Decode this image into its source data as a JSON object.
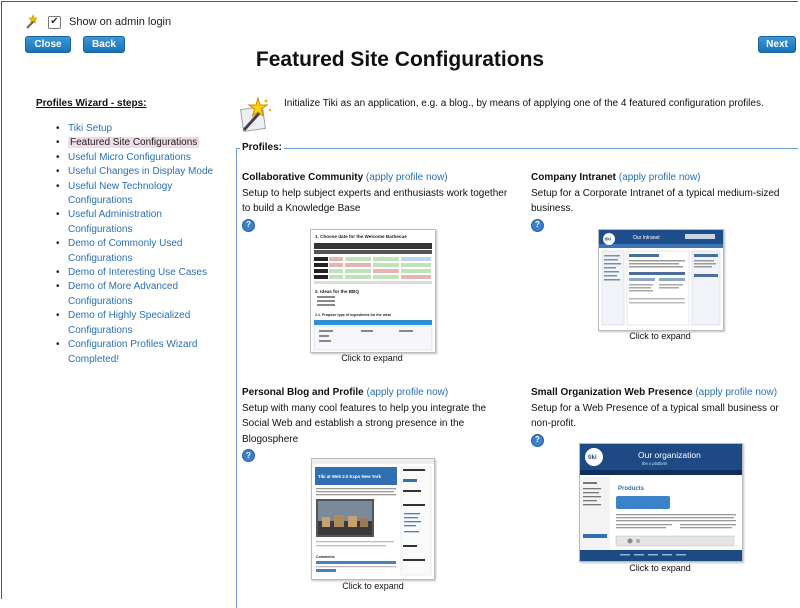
{
  "admin": {
    "show_label": "Show on admin login",
    "checked": true
  },
  "buttons": {
    "close": "Close",
    "back": "Back",
    "next": "Next"
  },
  "page_title": "Featured Site Configurations",
  "wizard": {
    "title": "Profiles Wizard - steps:",
    "steps": [
      "Tiki Setup",
      "Featured Site Configurations",
      "Useful Micro Configurations",
      "Useful Changes in Display Mode",
      "Useful New Technology Configurations",
      "Useful Administration Configurations",
      "Demo of Commonly Used Configurations",
      "Demo of Interesting Use Cases",
      "Demo of More Advanced Configurations",
      "Demo of Highly Specialized Configurations",
      "Configuration Profiles Wizard Completed!"
    ],
    "current_index": 1
  },
  "intro": "Initialize Tiki as an application, e.g. a blog., by means of applying one of the 4 featured configuration profiles.",
  "profiles_legend": "Profiles:",
  "profiles": [
    {
      "name": "Collaborative Community",
      "apply": "(apply profile now)",
      "desc": "Setup to help subject experts and enthusiasts work together to build a Knowledge Base",
      "caption": "Click to expand"
    },
    {
      "name": "Company Intranet",
      "apply": "(apply profile now)",
      "desc": "Setup for a Corporate Intranet of a typical medium-sized business.",
      "caption": "Click to expand"
    },
    {
      "name": "Personal Blog and Profile",
      "apply": "(apply profile now)",
      "desc": "Setup with many cool features to help you integrate the Social Web and establish a strong presence in the Blogosphere",
      "caption": "Click to expand"
    },
    {
      "name": "Small Organization Web Presence",
      "apply": "(apply profile now)",
      "desc": "Setup for a Web Presence of a typical small business or non-profit.",
      "caption": "Click to expand"
    }
  ],
  "thumbnails": {
    "collab_heading": "1. Choose date for the Welcome Barbecue",
    "collab_section": "2. Ideas for the BBQ",
    "collab_sub": "2.1. Propose type of ingredients for the meal",
    "intranet_logo": "tiki",
    "intranet_title": "Our Intranet",
    "blog_title": "Tiki at Web 2.0 Expo New York",
    "blog_comments": "Comments",
    "org_logo": "tiki",
    "org_title": "Our organization",
    "org_subtitle": "the x platform",
    "org_products": "Products"
  },
  "help_icon_glyph": "?"
}
